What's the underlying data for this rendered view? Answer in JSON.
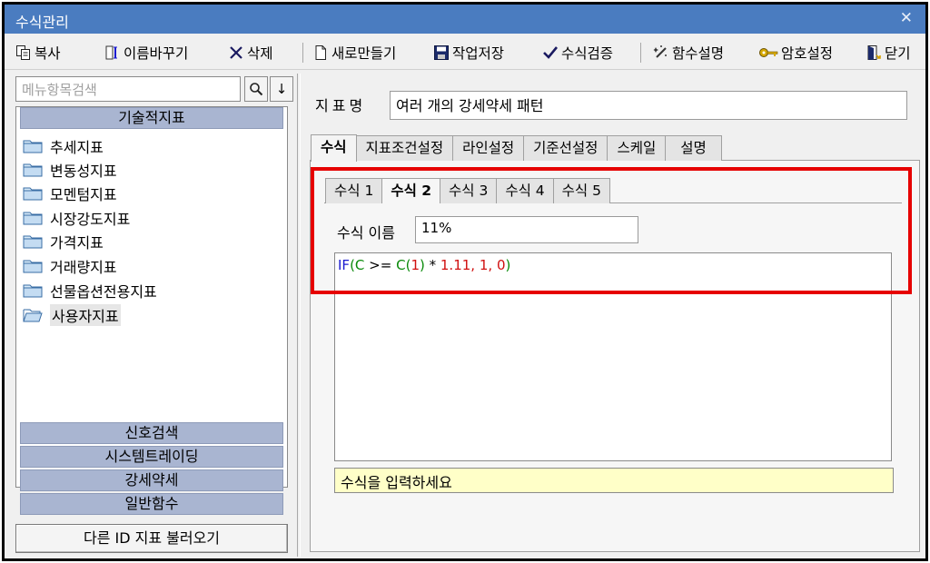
{
  "window": {
    "title": "수식관리",
    "close_glyph": "✕"
  },
  "toolbar": {
    "copy": "복사",
    "rename": "이름바꾸기",
    "delete": "삭제",
    "new": "새로만들기",
    "save": "작업저장",
    "verify": "수식검증",
    "func_help": "함수설명",
    "password": "암호설정",
    "close": "닫기"
  },
  "sidebar": {
    "search_placeholder": "메뉴항목검색",
    "search_glyph": "🔍",
    "down_glyph": "↓",
    "section_technical": "기술적지표",
    "items": [
      {
        "label": "추세지표"
      },
      {
        "label": "변동성지표"
      },
      {
        "label": "모멘텀지표"
      },
      {
        "label": "시장강도지표"
      },
      {
        "label": "가격지표"
      },
      {
        "label": "거래량지표"
      },
      {
        "label": "선물옵션전용지표"
      },
      {
        "label": "사용자지표",
        "selected": true
      }
    ],
    "sections": [
      "신호검색",
      "시스템트레이딩",
      "강세약세",
      "일반함수"
    ],
    "load_button": "다른 ID 지표 불러오기"
  },
  "main": {
    "indicator_label": "지표명",
    "indicator_name": "여러 개의 강세약세 패턴",
    "tabs": [
      "수식",
      "지표조건설정",
      "라인설정",
      "기준선설정",
      "스케일",
      "설명"
    ],
    "active_tab": "수식",
    "formula_tabs": [
      "수식 1",
      "수식 2",
      "수식 3",
      "수식 4",
      "수식 5"
    ],
    "active_formula_tab": "수식 2",
    "formula_name_label": "수식 이름",
    "formula_name_value": "11%",
    "formula": {
      "fn": "IF",
      "p1": "(",
      "v1": "C",
      "op1": " >= ",
      "v2": "C",
      "p2": "(",
      "n1": "1",
      "p3": ")",
      "op2": " * ",
      "n2": "1.11",
      "c1": ", ",
      "n3": "1",
      "c2": ", ",
      "n4": "0",
      "p4": ")"
    },
    "hint": "수식을 입력하세요"
  },
  "colors": {
    "titlebar": "#4a7cc0",
    "section_header": "#a9b5d1",
    "highlight_box": "#e60000",
    "hint_bg": "#ffffc8",
    "formula_function": "#1a1ad0",
    "formula_variable": "#0a8a0a",
    "formula_number": "#d01010"
  }
}
